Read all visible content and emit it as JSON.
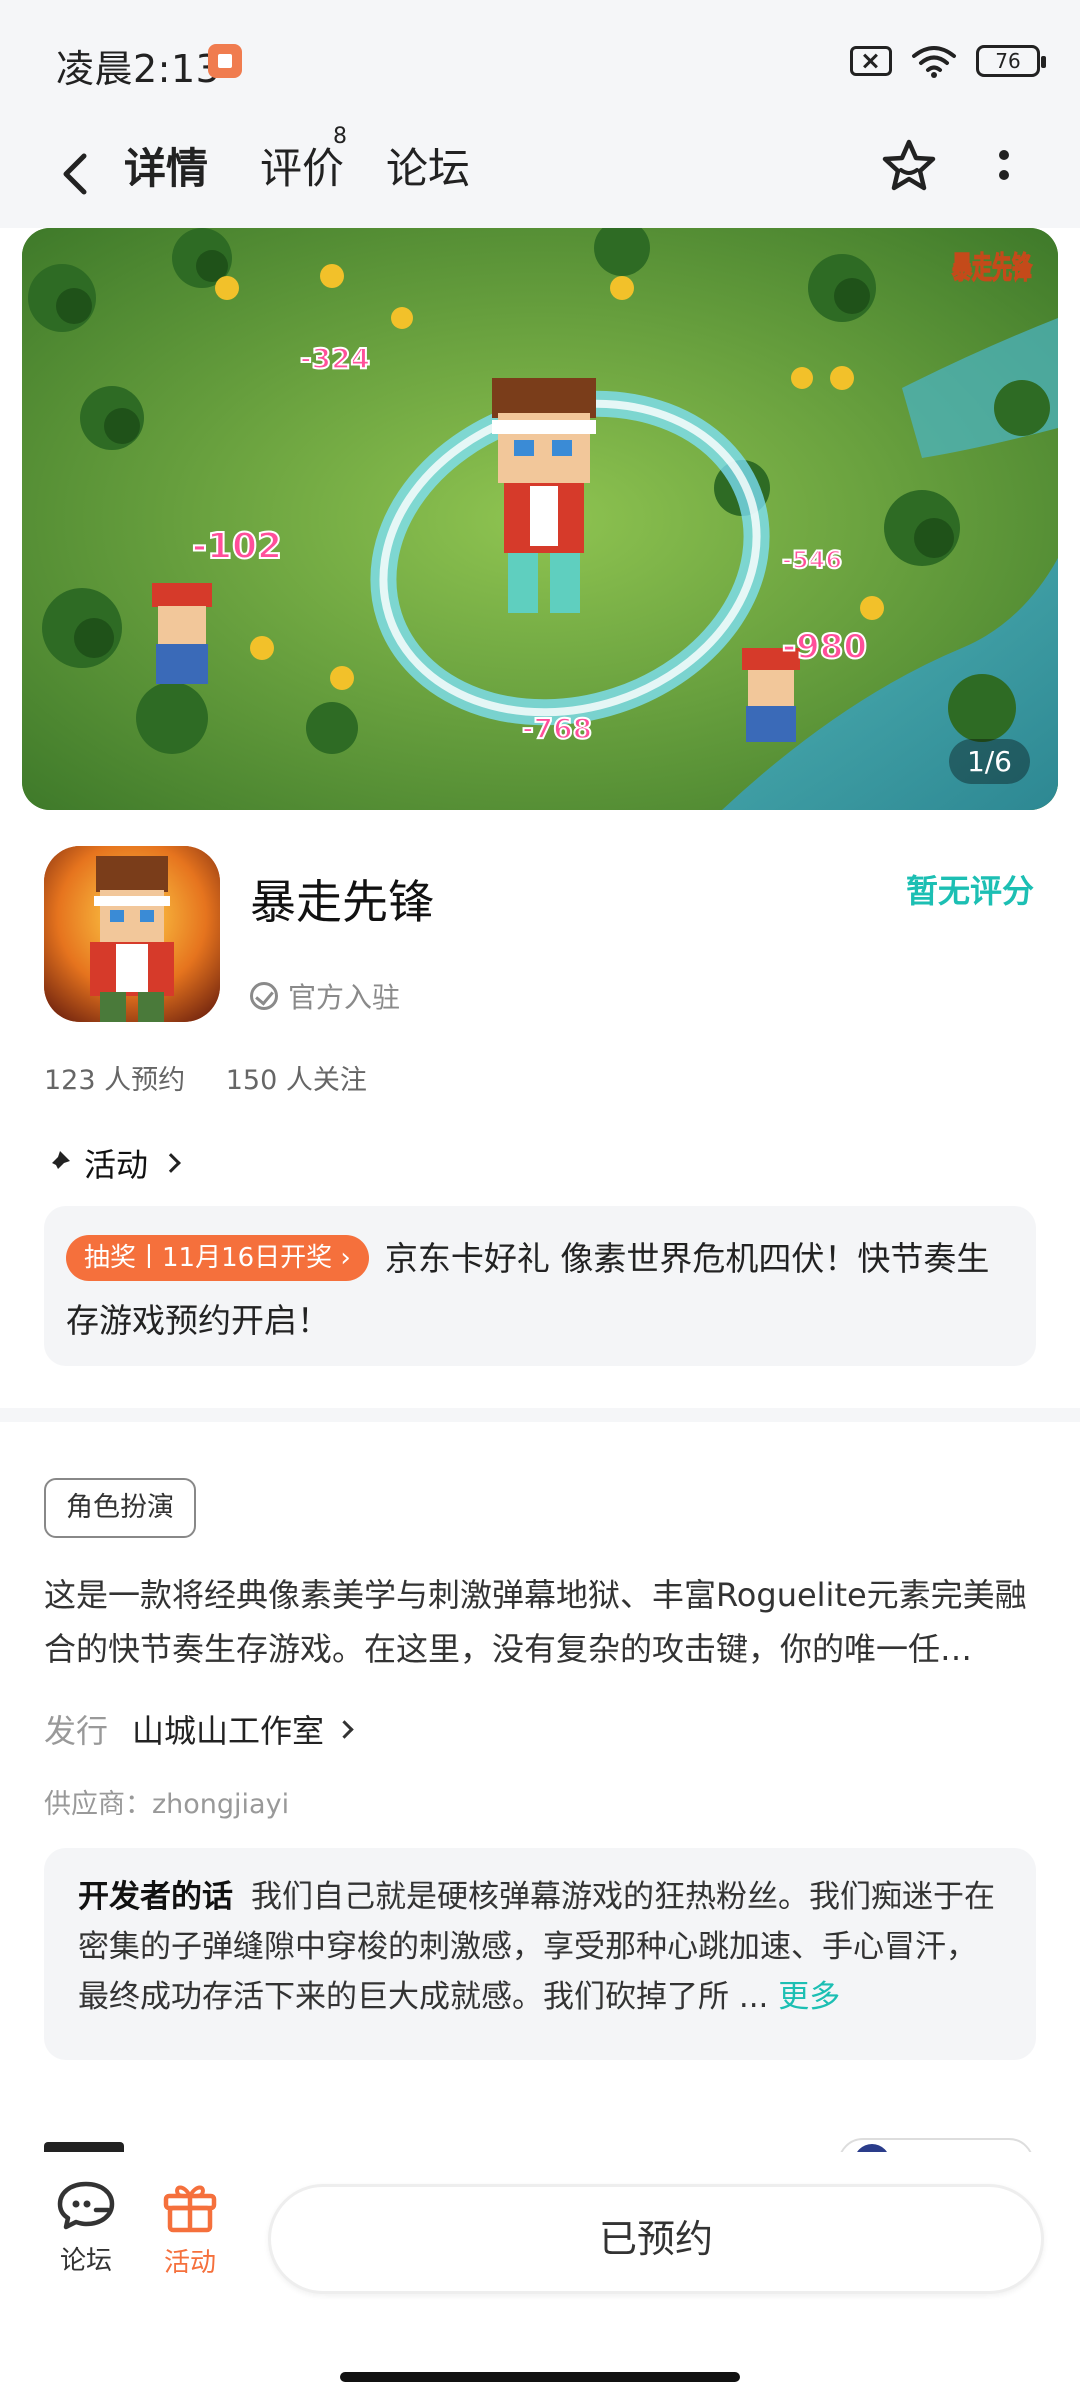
{
  "status_bar": {
    "time": "凌晨2:13",
    "battery": "76"
  },
  "header": {
    "tabs": [
      {
        "label": "详情",
        "active": true
      },
      {
        "label": "评价",
        "badge": "8"
      },
      {
        "label": "论坛"
      }
    ],
    "icons": [
      "back-arrow-icon",
      "star-icon",
      "more-vertical-icon"
    ]
  },
  "banner": {
    "counter": "1/6",
    "logo_text": "暴走先锋",
    "damage_numbers": [
      "-324",
      "-102",
      "-546",
      "-980",
      "-768"
    ]
  },
  "game": {
    "title": "暴走先锋",
    "official_label": "官方入驻",
    "rating_label": "暂无评分",
    "reservations": "123 人预约",
    "followers": "150 人关注"
  },
  "activity": {
    "heading": "活动",
    "tag": "抽奖丨11月16日开奖",
    "text": "京东卡好礼 像素世界危机四伏！快节奏生存游戏预约开启！"
  },
  "details": {
    "genre": "角色扮演",
    "description": "这是一款将经典像素美学与刺激弹幕地狱、丰富Roguelite元素完美融合的快节奏生存游戏。在这里，没有复杂的攻击键，你的唯一任…",
    "publisher_label": "发行",
    "publisher_name": "山城山工作室",
    "supplier": "供应商：zhongjiayi"
  },
  "developer_note": {
    "label": "开发者的话",
    "text": "我们自己就是硬核弹幕游戏的狂热粉丝。我们痴迷于在密集的子弹缝隙中穿梭的刺激感，享受那种心跳加速、手心冒汗，最终成功存活下来的巨大成就感。我们砍掉了所 ...",
    "more": "更多"
  },
  "bottom_bar": {
    "forum_label": "论坛",
    "activity_label": "活动",
    "reserve_button": "已预约"
  },
  "colors": {
    "accent_teal": "#1cbfb3",
    "accent_orange": "#f5703c"
  }
}
